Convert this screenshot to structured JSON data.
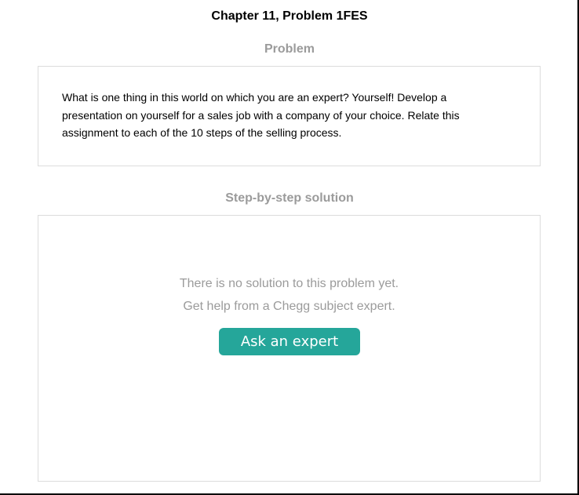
{
  "header": {
    "title": "Chapter 11, Problem 1FES"
  },
  "problem": {
    "heading": "Problem",
    "text": "What is one thing in this world on which you are an expert? Yourself! Develop a presentation on yourself for a sales job with a company of your choice. Relate this assignment to each of the 10 steps of the selling process."
  },
  "solution": {
    "heading": "Step-by-step solution",
    "empty_line1": "There is no solution to this problem yet.",
    "empty_line2": "Get help from a Chegg subject expert.",
    "ask_button_label": "Ask an expert"
  },
  "colors": {
    "accent": "#25a69a",
    "muted_text": "#9b9b9b",
    "border": "#dcdcdc"
  }
}
